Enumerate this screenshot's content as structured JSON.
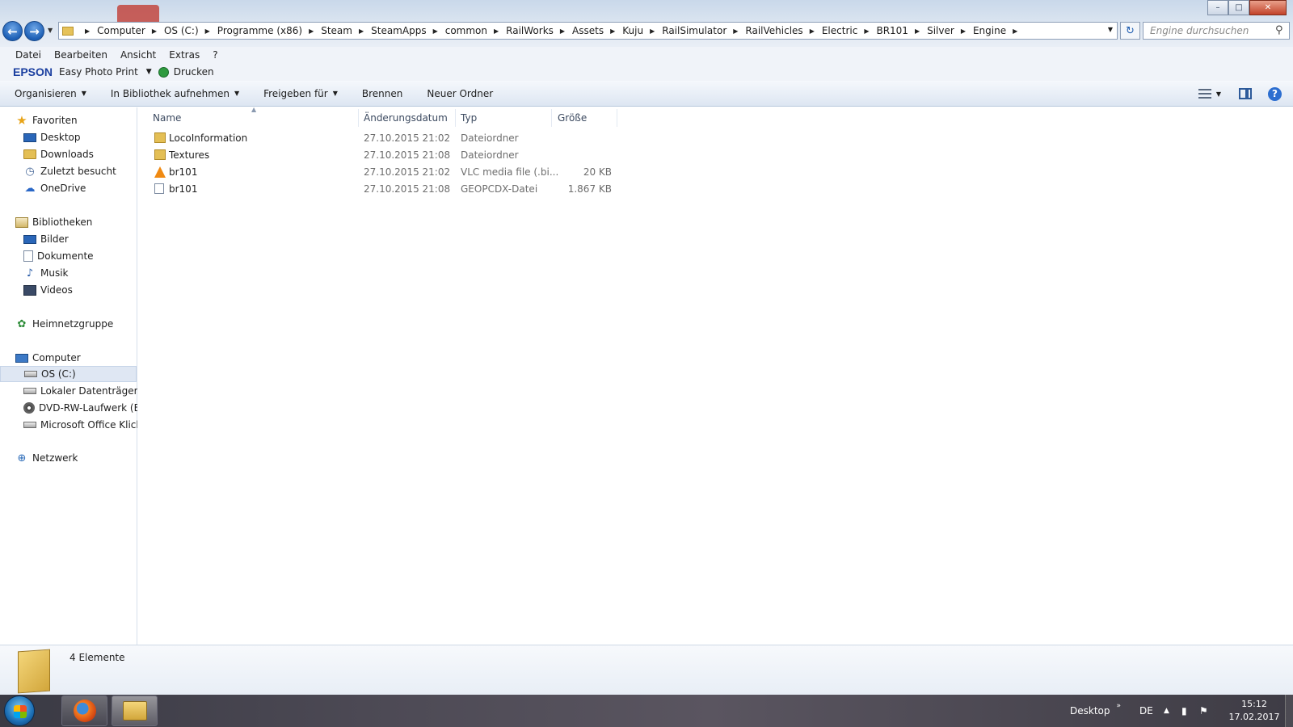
{
  "window": {
    "controls": {
      "minimize": "–",
      "maximize": "□",
      "close": "✕"
    }
  },
  "nav": {
    "back_icon": "←",
    "forward_icon": "→",
    "history_dropdown": "▼"
  },
  "address": {
    "crumbs": [
      "Computer",
      "OS (C:)",
      "Programme (x86)",
      "Steam",
      "SteamApps",
      "common",
      "RailWorks",
      "Assets",
      "Kuju",
      "RailSimulator",
      "RailVehicles",
      "Electric",
      "BR101",
      "Silver",
      "Engine"
    ],
    "separator": "▶",
    "dropdown": "▼",
    "refresh_icon": "↻"
  },
  "search": {
    "placeholder": "Engine durchsuchen",
    "icon": "⚲"
  },
  "menu": {
    "items": [
      "Datei",
      "Bearbeiten",
      "Ansicht",
      "Extras",
      "?"
    ]
  },
  "epson": {
    "logo": "EPSON",
    "app": "Easy Photo Print",
    "dropdown": "▼",
    "print": "Drucken"
  },
  "commandbar": {
    "organize": "Organisieren",
    "library": "In Bibliothek aufnehmen",
    "share": "Freigeben für",
    "burn": "Brennen",
    "new_folder": "Neuer Ordner",
    "dropdown": "▼",
    "view_dropdown": "▼",
    "help": "?"
  },
  "sidebar": {
    "favorites": {
      "label": "Favoriten",
      "items": [
        "Desktop",
        "Downloads",
        "Zuletzt besucht",
        "OneDrive"
      ]
    },
    "libraries": {
      "label": "Bibliotheken",
      "items": [
        "Bilder",
        "Dokumente",
        "Musik",
        "Videos"
      ]
    },
    "homegroup": {
      "label": "Heimnetzgruppe"
    },
    "computer": {
      "label": "Computer",
      "items": [
        "OS (C:)",
        "Lokaler Datenträger (D",
        "DVD-RW-Laufwerk (E:)",
        "Microsoft Office Klick-"
      ]
    },
    "network": {
      "label": "Netzwerk"
    }
  },
  "filelist": {
    "columns": {
      "name": "Name",
      "date": "Änderungsdatum",
      "type": "Typ",
      "size": "Größe"
    },
    "sort_indicator": "▲",
    "rows": [
      {
        "name": "LocoInformation",
        "date": "27.10.2015 21:02",
        "type": "Dateiordner",
        "size": "",
        "icon": "folder-icon"
      },
      {
        "name": "Textures",
        "date": "27.10.2015 21:08",
        "type": "Dateiordner",
        "size": "",
        "icon": "folder-icon"
      },
      {
        "name": "br101",
        "date": "27.10.2015 21:02",
        "type": "VLC media file (.bi...",
        "size": "20 KB",
        "icon": "vlc-file-icon"
      },
      {
        "name": "br101",
        "date": "27.10.2015 21:08",
        "type": "GEOPCDX-Datei",
        "size": "1.867 KB",
        "icon": "document-file-icon"
      }
    ]
  },
  "details": {
    "count_text": "4 Elemente"
  },
  "taskbar": {
    "desktop_label": "Desktop",
    "expand": "»",
    "language": "DE",
    "tray_arrow": "▲",
    "time": "15:12",
    "date": "17.02.2017"
  },
  "colors": {
    "accent": "#2c6ed0",
    "folder": "#e4bf55",
    "selection": "#dfe7f3"
  }
}
